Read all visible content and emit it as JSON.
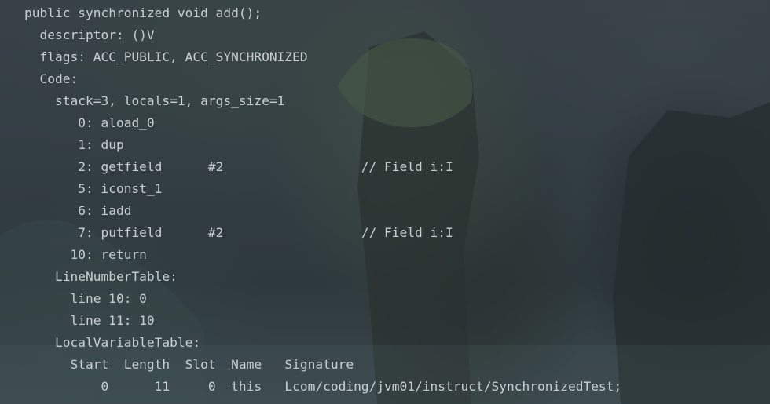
{
  "code": {
    "lines": [
      "public synchronized void add();",
      "  descriptor: ()V",
      "  flags: ACC_PUBLIC, ACC_SYNCHRONIZED",
      "  Code:",
      "    stack=3, locals=1, args_size=1",
      "       0: aload_0",
      "       1: dup",
      "       2: getfield      #2                  // Field i:I",
      "       5: iconst_1",
      "       6: iadd",
      "       7: putfield      #2                  // Field i:I",
      "      10: return",
      "    LineNumberTable:",
      "      line 10: 0",
      "      line 11: 10",
      "    LocalVariableTable:",
      "      Start  Length  Slot  Name   Signature",
      "          0      11     0  this   Lcom/coding/jvm01/instruct/SynchronizedTest;"
    ]
  },
  "colors": {
    "text": "#c9cfd2",
    "background": "#323d42"
  }
}
